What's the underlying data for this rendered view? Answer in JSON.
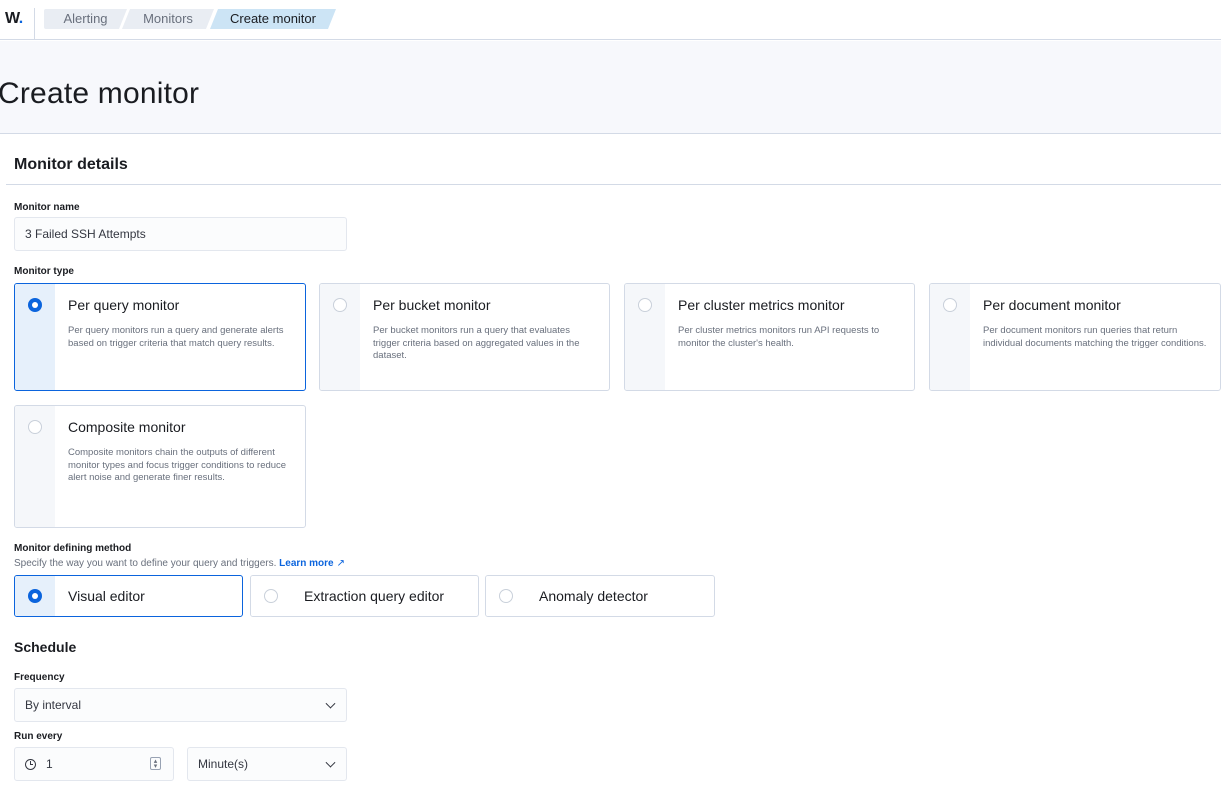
{
  "brand": {
    "logo_text": "W",
    "logo_dot": "."
  },
  "breadcrumbs": [
    "Alerting",
    "Monitors",
    "Create monitor"
  ],
  "page_title": "Create monitor",
  "monitor_details": {
    "section_title": "Monitor details",
    "name_label": "Monitor name",
    "name_value": "3 Failed SSH Attempts",
    "type_label": "Monitor type",
    "types": [
      {
        "title": "Per query monitor",
        "desc": "Per query monitors run a query and generate alerts based on trigger criteria that match query results.",
        "selected": true
      },
      {
        "title": "Per bucket monitor",
        "desc": "Per bucket monitors run a query that evaluates trigger criteria based on aggregated values in the dataset.",
        "selected": false
      },
      {
        "title": "Per cluster metrics monitor",
        "desc": "Per cluster metrics monitors run API requests to monitor the cluster's health.",
        "selected": false
      },
      {
        "title": "Per document monitor",
        "desc": "Per document monitors run queries that return individual documents matching the trigger conditions.",
        "selected": false
      },
      {
        "title": "Composite monitor",
        "desc": "Composite monitors chain the outputs of different monitor types and focus trigger conditions to reduce alert noise and generate finer results.",
        "selected": false
      }
    ],
    "method_label": "Monitor defining method",
    "method_help": "Specify the way you want to define your query and triggers.",
    "method_help_link": "Learn more",
    "methods": [
      {
        "title": "Visual editor",
        "selected": true
      },
      {
        "title": "Extraction query editor",
        "selected": false
      },
      {
        "title": "Anomaly detector",
        "selected": false
      }
    ]
  },
  "schedule": {
    "title": "Schedule",
    "frequency_label": "Frequency",
    "frequency_value": "By interval",
    "run_every_label": "Run every",
    "run_every_value": "1",
    "run_every_unit": "Minute(s)"
  },
  "colors": {
    "accent": "#0b64dd",
    "border": "#d3dae6",
    "header_bg": "#f7f8fc"
  },
  "icons": {
    "clock": "clock-icon",
    "external": "external-link-icon",
    "chevron": "chevron-down-icon",
    "stepper": "stepper-icon"
  }
}
